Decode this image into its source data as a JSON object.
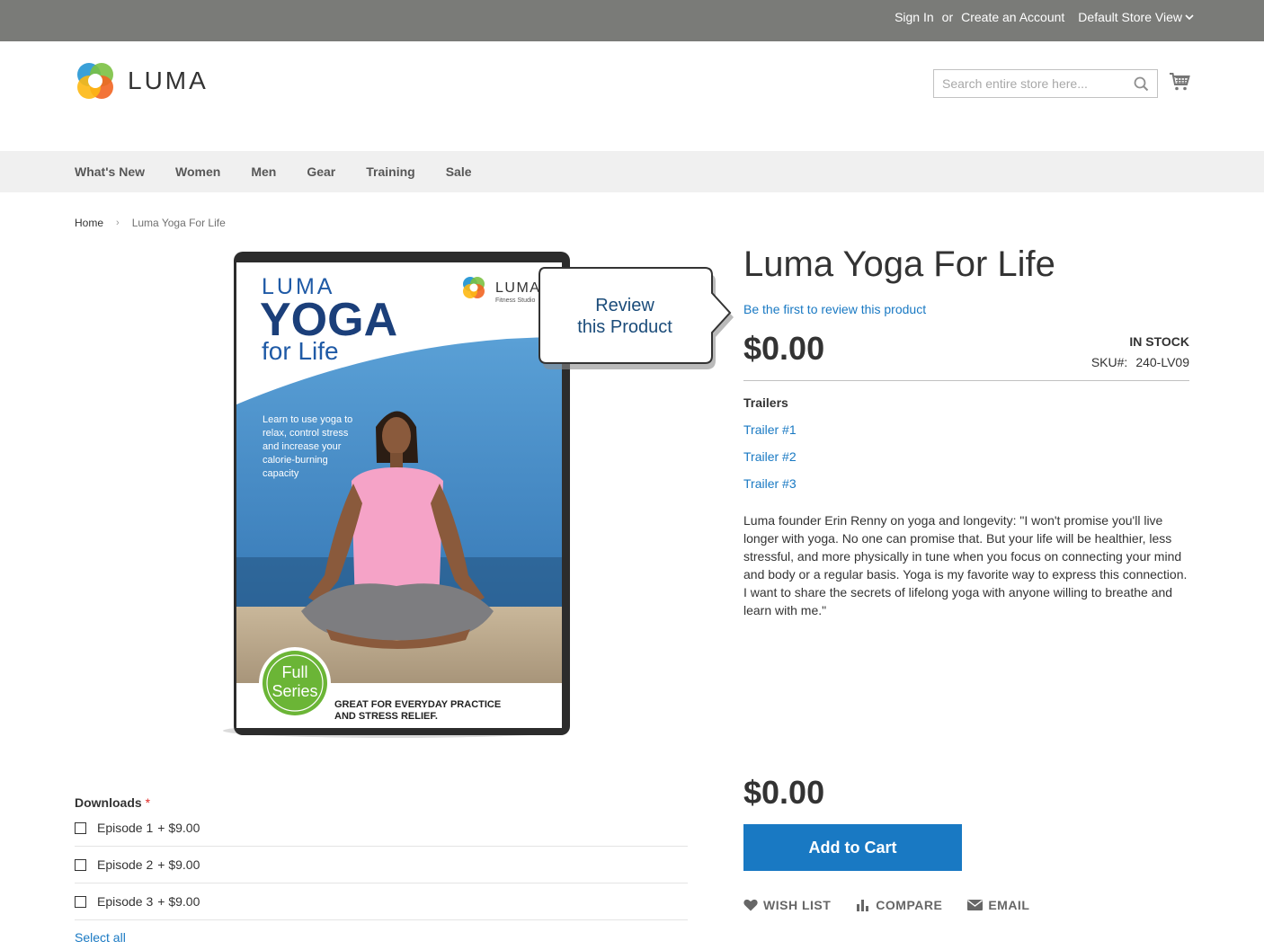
{
  "header": {
    "sign_in": "Sign In",
    "or": "or",
    "create_account": "Create an Account",
    "store_view": "Default Store View",
    "logo_text": "LUMA",
    "search_placeholder": "Search entire store here..."
  },
  "nav": {
    "items": [
      "What's New",
      "Women",
      "Men",
      "Gear",
      "Training",
      "Sale"
    ]
  },
  "breadcrumb": {
    "home": "Home",
    "current": "Luma Yoga For Life"
  },
  "image": {
    "cover_brand": "LUMA",
    "cover_title": "YOGA",
    "cover_subtitle": "for Life",
    "cover_logo_text": "LUMA",
    "cover_logo_sub": "Fitness Studio",
    "cover_blurb": [
      "Learn to use yoga to",
      "relax, control stress",
      "and increase your",
      "calorie-burning",
      "capacity"
    ],
    "badge_line1": "Full",
    "badge_line2": "Series",
    "footer_line1": "GREAT FOR EVERYDAY PRACTICE",
    "footer_line2": "AND STRESS RELIEF.",
    "callout_line1": "Review",
    "callout_line2": "this Product"
  },
  "product": {
    "title": "Luma Yoga For Life",
    "review_link": "Be the first to review this product",
    "price": "$0.00",
    "stock": "In stock",
    "sku_label": "SKU#:",
    "sku_value": "240-LV09",
    "trailers_title": "Trailers",
    "trailers": [
      "Trailer #1",
      "Trailer #2",
      "Trailer #3"
    ],
    "description": "Luma founder Erin Renny on yoga and longevity: \"I won't promise you'll live longer with yoga. No one can promise that. But your life will be healthier, less stressful, and more physically in tune when you focus on connecting your mind and body or a regular basis. Yoga is my favorite way to express this connection. I want to share the secrets of lifelong yoga with anyone willing to breathe and learn with me.\""
  },
  "downloads": {
    "title": "Downloads",
    "required_mark": "*",
    "items": [
      {
        "name": "Episode 1",
        "price": "+ $9.00"
      },
      {
        "name": "Episode 2",
        "price": "+ $9.00"
      },
      {
        "name": "Episode 3",
        "price": "+ $9.00"
      }
    ],
    "select_all": "Select all"
  },
  "cart": {
    "price": "$0.00",
    "add_to_cart": "Add to Cart",
    "wish_list": "Wish List",
    "compare": "Compare",
    "email": "Email"
  },
  "colors": {
    "topbar": "#7a7b78",
    "link": "#1979c3",
    "button": "#1979c3",
    "nav_bg": "#f0f0f0"
  }
}
